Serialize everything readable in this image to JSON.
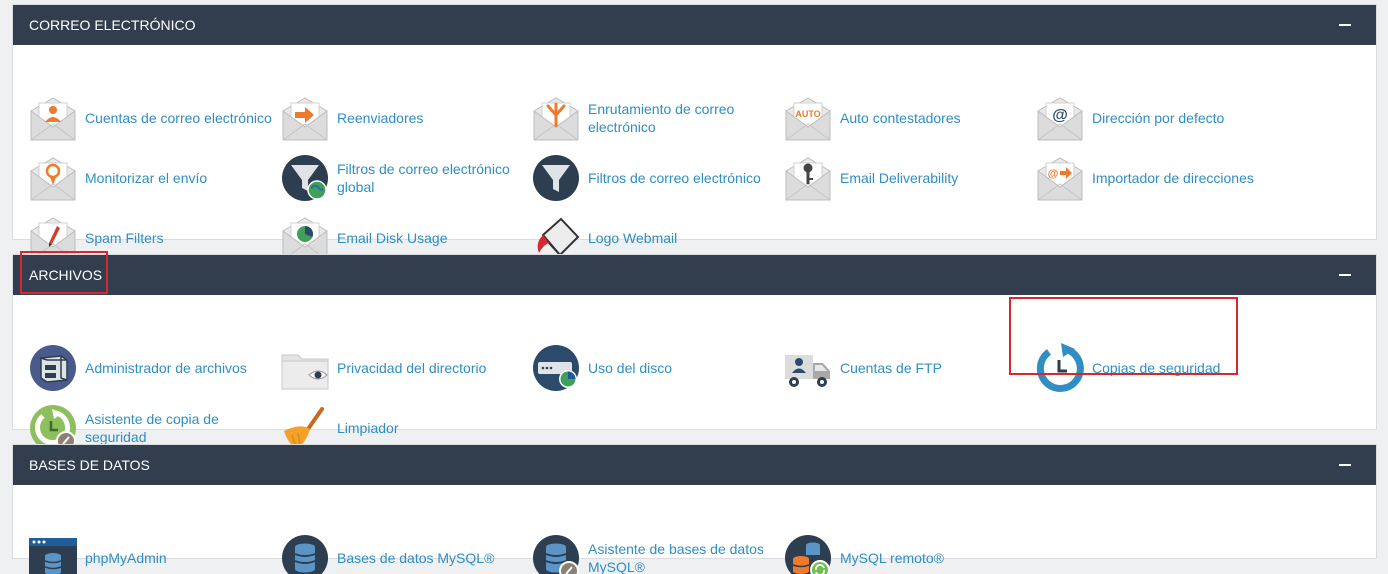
{
  "sections": {
    "email": {
      "title": "CORREO ELECTRÓNICO",
      "items": [
        {
          "label": "Cuentas de correo electrónico",
          "icon": "email-account-icon"
        },
        {
          "label": "Reenviadores",
          "icon": "forwarder-icon"
        },
        {
          "label": "Enrutamiento de correo electrónico",
          "icon": "email-routing-icon"
        },
        {
          "label": "Auto contestadores",
          "icon": "autoresponder-icon"
        },
        {
          "label": "Dirección por defecto",
          "icon": "default-address-icon"
        },
        {
          "label": "Monitorizar el envío",
          "icon": "track-delivery-icon"
        },
        {
          "label": "Filtros de correo electrónico global",
          "icon": "global-filter-icon"
        },
        {
          "label": "Filtros de correo electrónico",
          "icon": "email-filter-icon"
        },
        {
          "label": "Email Deliverability",
          "icon": "email-deliverability-icon"
        },
        {
          "label": "Importador de direcciones",
          "icon": "address-importer-icon"
        },
        {
          "label": "Spam Filters",
          "icon": "spam-filter-icon"
        },
        {
          "label": "Email Disk Usage",
          "icon": "email-disk-usage-icon"
        },
        {
          "label": "Logo Webmail",
          "icon": "webmail-logo-icon"
        }
      ]
    },
    "files": {
      "title": "ARCHIVOS",
      "items": [
        {
          "label": "Administrador de archivos",
          "icon": "file-manager-icon"
        },
        {
          "label": "Privacidad del directorio",
          "icon": "directory-privacy-icon"
        },
        {
          "label": "Uso del disco",
          "icon": "disk-usage-icon"
        },
        {
          "label": "Cuentas de FTP",
          "icon": "ftp-accounts-icon"
        },
        {
          "label": "Copias de seguridad",
          "icon": "backup-icon"
        },
        {
          "label": "Asistente de copia de seguridad",
          "icon": "backup-wizard-icon"
        },
        {
          "label": "Limpiador",
          "icon": "cleaner-icon"
        }
      ]
    },
    "databases": {
      "title": "BASES DE DATOS",
      "items": [
        {
          "label": "phpMyAdmin",
          "icon": "phpmyadmin-icon"
        },
        {
          "label": "Bases de datos MySQL®",
          "icon": "mysql-databases-icon"
        },
        {
          "label": "Asistente de bases de datos MySQL®",
          "icon": "mysql-wizard-icon"
        },
        {
          "label": "MySQL remoto®",
          "icon": "remote-mysql-icon"
        }
      ]
    }
  },
  "colors": {
    "header_bg": "#323e4e",
    "link": "#2f8ec4",
    "accent_orange": "#ee7a2b",
    "highlight": "#d8282f"
  }
}
